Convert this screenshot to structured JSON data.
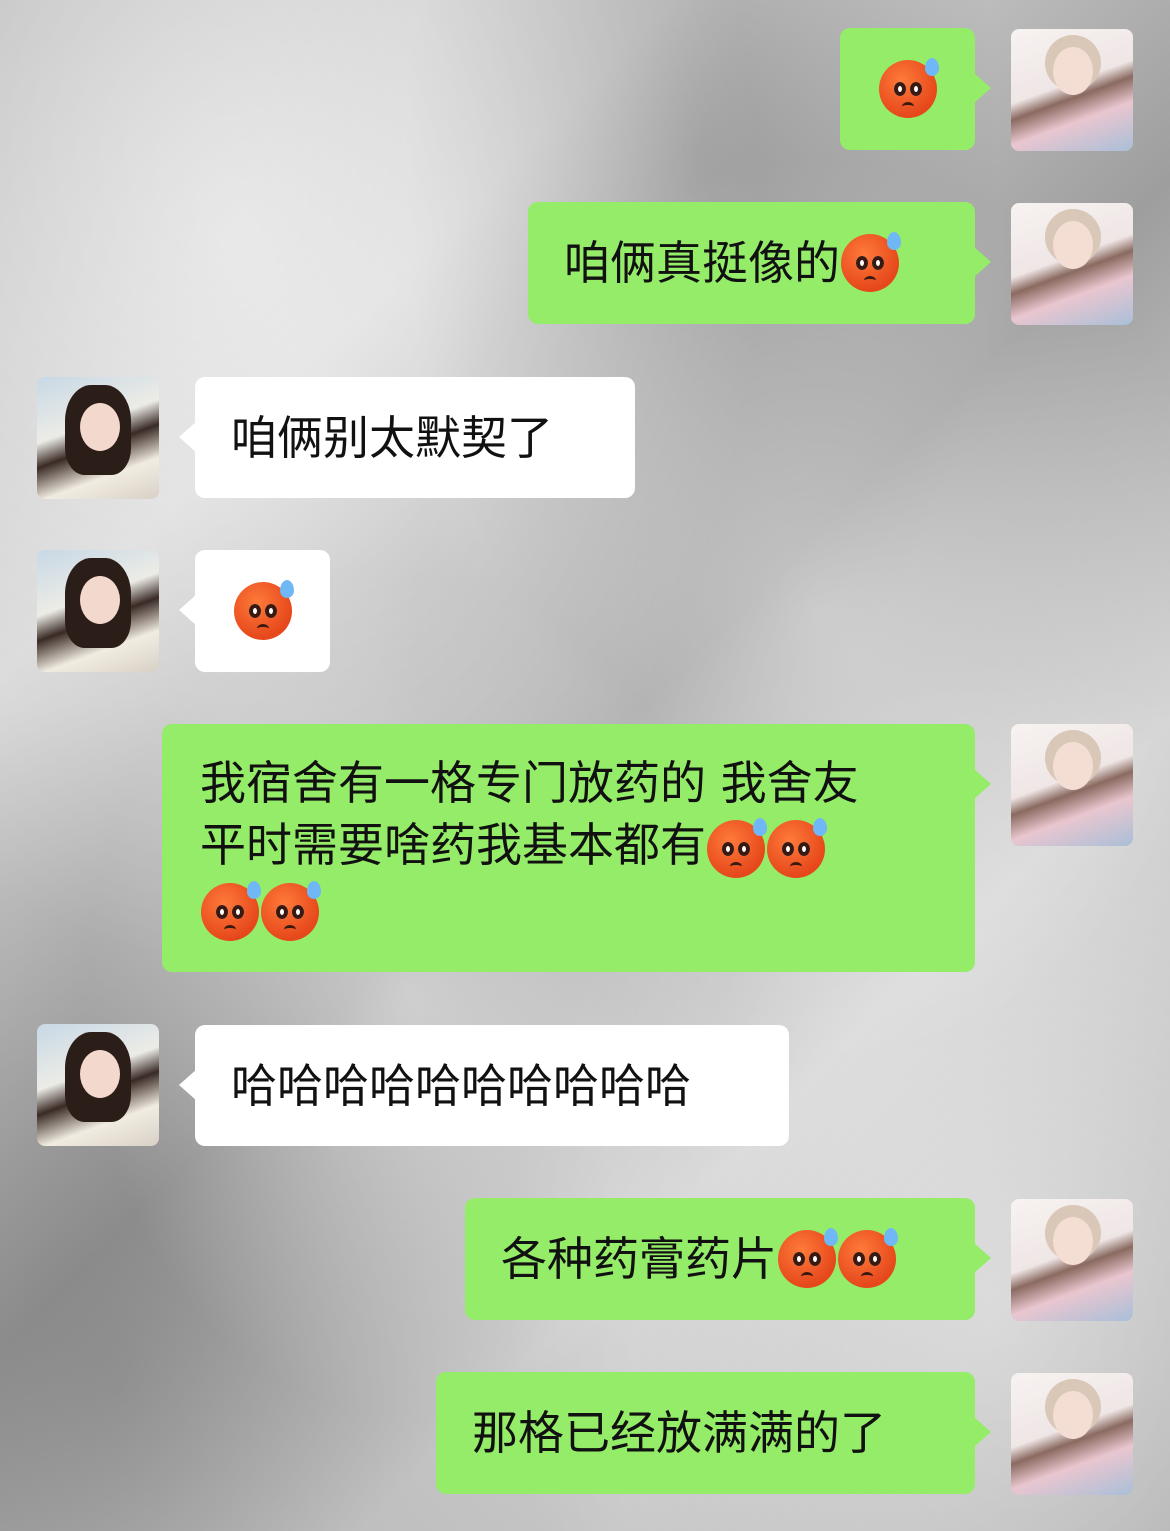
{
  "messages": [
    {
      "sender": "me",
      "text": "",
      "emojis": 1
    },
    {
      "sender": "me",
      "text": "咱俩真挺像的",
      "emojis": 1
    },
    {
      "sender": "other",
      "text": "咱俩别太默契了",
      "emojis": 0
    },
    {
      "sender": "other",
      "text": "",
      "emojis": 1
    },
    {
      "sender": "me",
      "line1": "我宿舍有一格专门放药的 我舍友",
      "line2": "平时需要啥药我基本都有",
      "emojis": 4
    },
    {
      "sender": "other",
      "text": "哈哈哈哈哈哈哈哈哈哈",
      "emojis": 0
    },
    {
      "sender": "me",
      "text": "各种药膏药片",
      "emojis": 2
    },
    {
      "sender": "me",
      "text": "那格已经放满满的了",
      "emojis": 0
    }
  ],
  "emoji_name": "anxious-face-with-sweat",
  "colors": {
    "my_bubble": "#95ec69",
    "other_bubble": "#ffffff"
  }
}
